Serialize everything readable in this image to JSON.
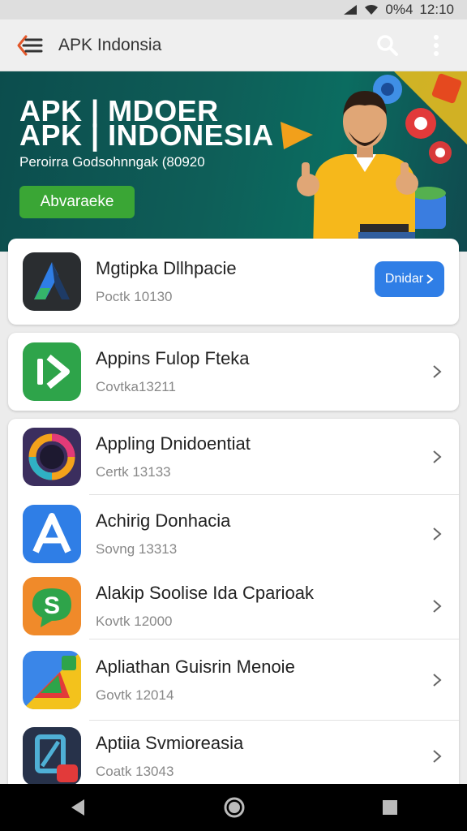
{
  "status": {
    "battery": "0%4",
    "time": "12:10"
  },
  "appbar": {
    "title": "APK Indonsia"
  },
  "banner": {
    "line1": "APK | MDOER",
    "line2": "APK | INDONESIA",
    "subtitle": "Peroirra Godsohnngak (80920",
    "button": "Abvaraeke"
  },
  "featured": {
    "name": "Mgtipka Dllhpacie",
    "meta": "Poctk 10130",
    "install_label": "Dnidar"
  },
  "apps": [
    {
      "name": "Appins Fulop Fteka",
      "meta": "Covtka13211",
      "icon": "play-arrow-icon"
    },
    {
      "name": "Appling Dnidoentiat",
      "meta": "Certk 13133",
      "icon": "ring-icon"
    },
    {
      "name": "Achirig Donhacia",
      "meta": "Sovng 13313",
      "icon": "letter-a-icon"
    },
    {
      "name": "Alakip Soolise Ida Cparioak",
      "meta": "Kovtk 12000",
      "icon": "chat-s-icon"
    },
    {
      "name": "Apliathan Guisrin Menoie",
      "meta": "Govtk 12014",
      "icon": "maps-icon"
    },
    {
      "name": "Aptiia Svmioreasia",
      "meta": "Coatk 13043",
      "icon": "frame-icon"
    }
  ],
  "colors": {
    "accent": "#2f7ee6",
    "banner": "#0e5e58",
    "green": "#3aa635"
  }
}
